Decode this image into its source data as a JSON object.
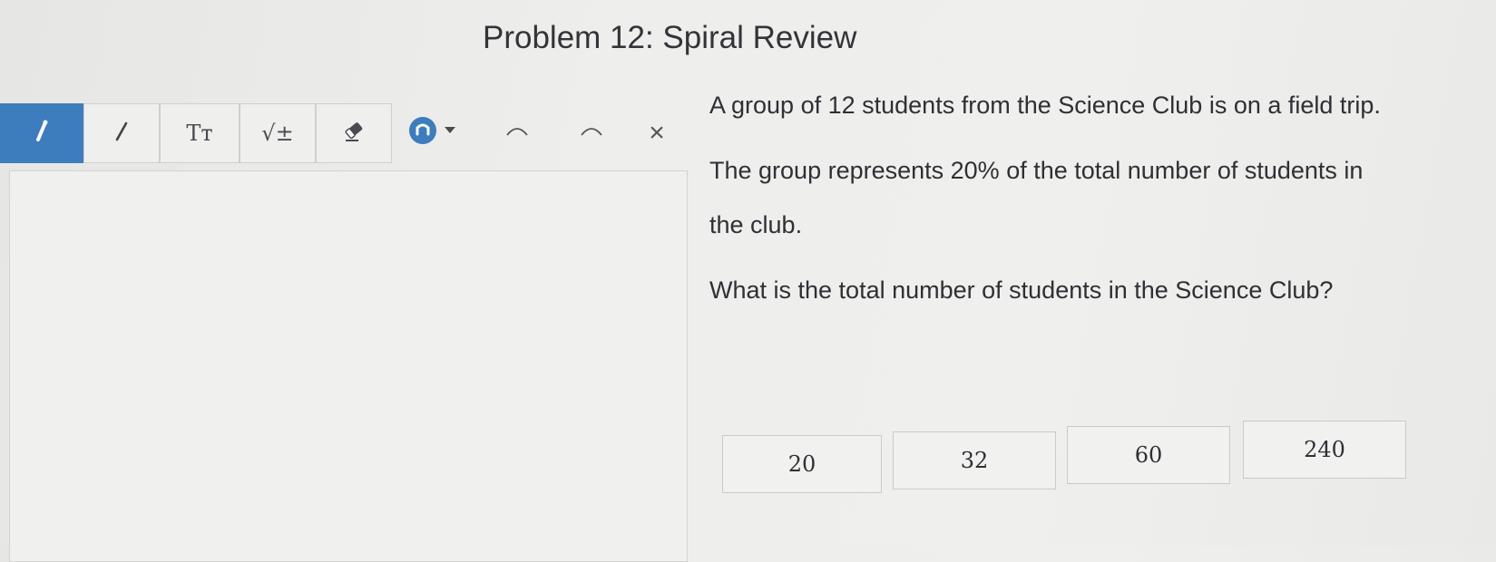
{
  "title": "Problem 12: Spiral Review",
  "toolbar": {
    "tools": [
      {
        "name": "pencil-tool",
        "icon": "pencil-icon",
        "active": true
      },
      {
        "name": "line-tool",
        "icon": "line-icon",
        "active": false
      },
      {
        "name": "text-tool",
        "icon": "text-size-icon",
        "label": "Tт",
        "active": false
      },
      {
        "name": "math-tool",
        "icon": "square-root-icon",
        "label": "√±",
        "active": false
      },
      {
        "name": "eraser-tool",
        "icon": "eraser-icon",
        "active": false
      }
    ],
    "color_icon": "color-swatch-icon",
    "undo_icon": "undo-icon",
    "redo_icon": "redo-icon",
    "clear_icon": "close-icon",
    "close_glyph": "×",
    "accent_color": "#3d7dbd"
  },
  "question": {
    "paragraphs": [
      "A group of 12 students from the Science Club is on a field trip.",
      "The group represents 20% of the total number of students in the club.",
      "What is the total number of students in the Science Club?"
    ]
  },
  "choices": [
    "20",
    "32",
    "60",
    "240"
  ]
}
